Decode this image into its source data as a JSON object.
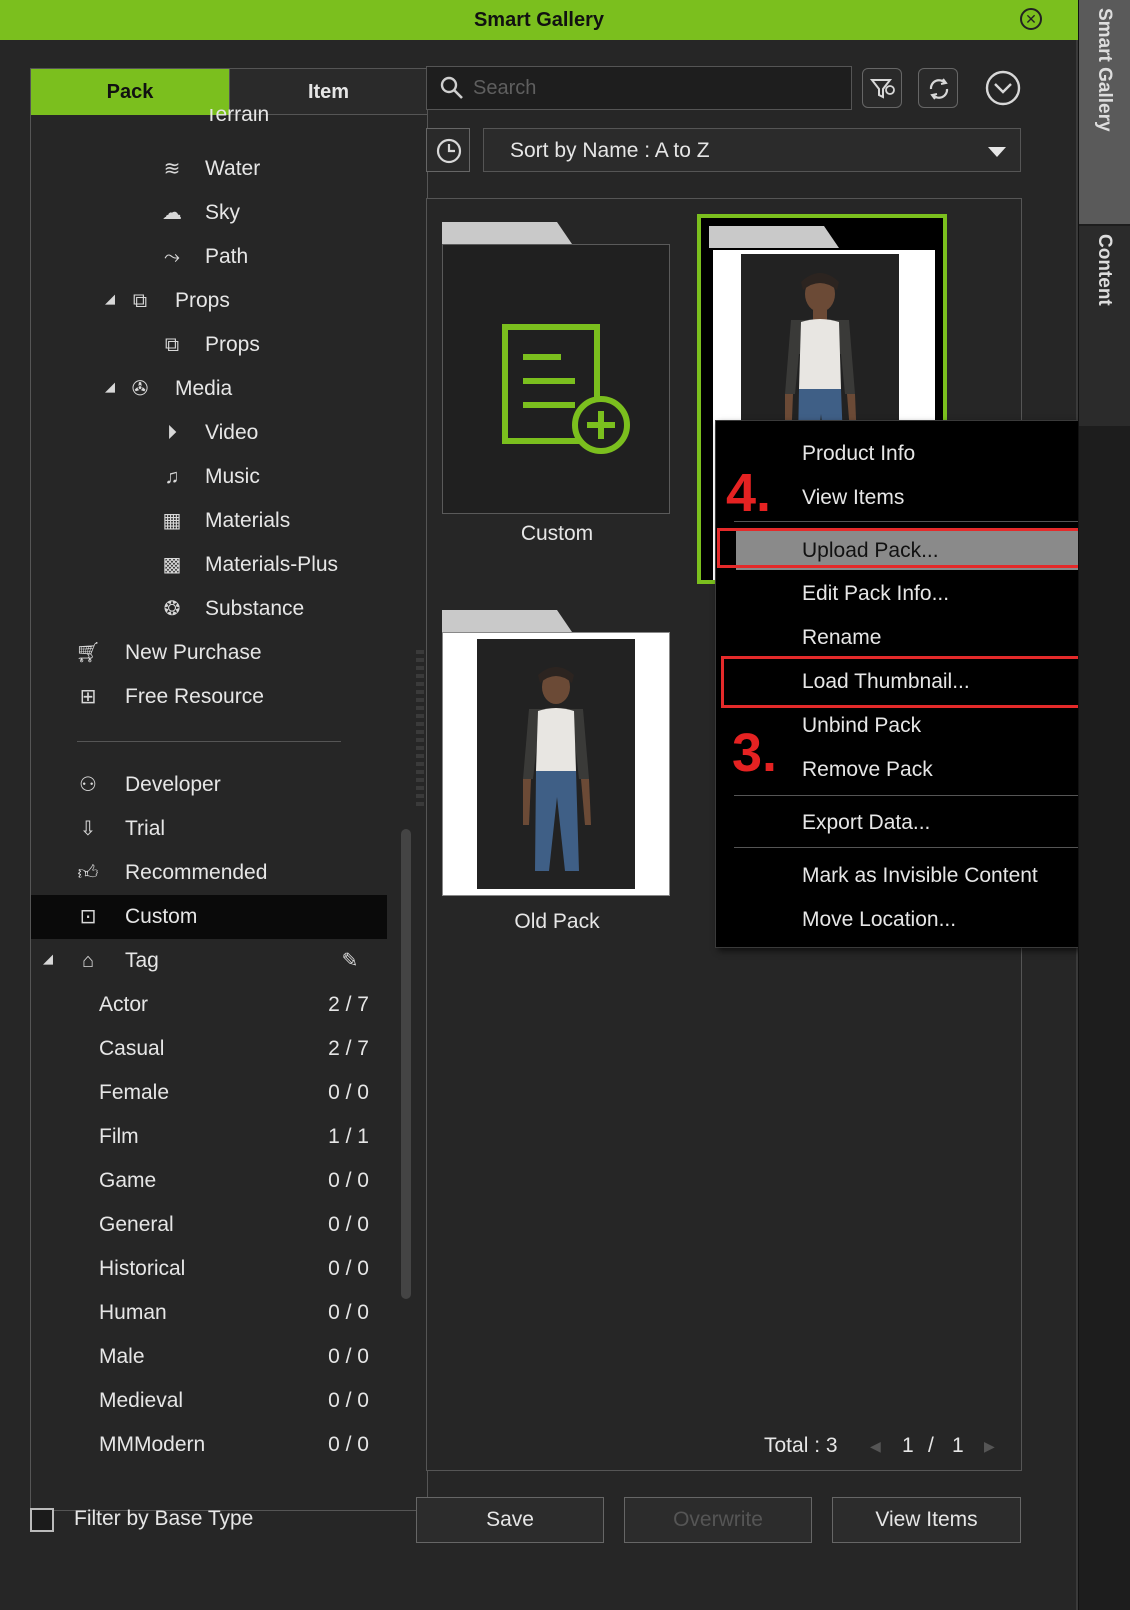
{
  "window": {
    "title": "Smart Gallery"
  },
  "rail": {
    "tabs": [
      "Smart Gallery",
      "Content"
    ]
  },
  "left": {
    "tabs": {
      "pack": "Pack",
      "item": "Item"
    },
    "tree": [
      {
        "label": "Terrain",
        "icon": "terrain-icon",
        "partial": true
      },
      {
        "label": "Water",
        "icon": "water-icon"
      },
      {
        "label": "Sky",
        "icon": "cloud-icon"
      },
      {
        "label": "Path",
        "icon": "path-icon"
      },
      {
        "label": "Props",
        "icon": "props-icon",
        "expanded": true
      },
      {
        "label": "Props",
        "icon": "props-icon"
      },
      {
        "label": "Media",
        "icon": "media-icon",
        "expanded": true
      },
      {
        "label": "Video",
        "icon": "play-icon"
      },
      {
        "label": "Music",
        "icon": "music-note-icon"
      },
      {
        "label": "Materials",
        "icon": "checker-icon"
      },
      {
        "label": "Materials-Plus",
        "icon": "checker-plus-icon"
      },
      {
        "label": "Substance",
        "icon": "substance-icon"
      },
      {
        "label": "New Purchase",
        "icon": "cart-icon"
      },
      {
        "label": "Free Resource",
        "icon": "gift-icon"
      },
      {
        "label": "Developer",
        "icon": "developer-icon"
      },
      {
        "label": "Trial",
        "icon": "trial-icon"
      },
      {
        "label": "Recommended",
        "icon": "thumbs-up-icon"
      },
      {
        "label": "Custom",
        "icon": "custom-icon",
        "selected": true
      },
      {
        "label": "Tag",
        "icon": "tag-icon",
        "expanded": true
      }
    ],
    "tags": [
      {
        "label": "Actor",
        "count": "2 / 7"
      },
      {
        "label": "Casual",
        "count": "2 / 7"
      },
      {
        "label": "Female",
        "count": "0 / 0"
      },
      {
        "label": "Film",
        "count": "1 / 1"
      },
      {
        "label": "Game",
        "count": "0 / 0"
      },
      {
        "label": "General",
        "count": "0 / 0"
      },
      {
        "label": "Historical",
        "count": "0 / 0"
      },
      {
        "label": "Human",
        "count": "0 / 0"
      },
      {
        "label": "Male",
        "count": "0 / 0"
      },
      {
        "label": "Medieval",
        "count": "0 / 0"
      },
      {
        "label": "MMModern",
        "count": "0 / 0"
      }
    ],
    "filter_label": "Filter by Base Type"
  },
  "search": {
    "placeholder": "Search"
  },
  "sort": {
    "label": "Sort by Name : A to Z"
  },
  "gallery": {
    "cards": [
      {
        "name": "Custom"
      },
      {
        "name": ""
      },
      {
        "name": "Old Pack"
      }
    ],
    "pager": {
      "total": "Total : 3",
      "page": "1",
      "slash": "/",
      "pages": "1"
    }
  },
  "buttons": {
    "save": "Save",
    "overwrite": "Overwrite",
    "view_items": "View Items"
  },
  "context_menu": {
    "items": [
      "Product Info",
      "View Items",
      "Upload Pack...",
      "Edit Pack Info...",
      "Rename",
      "Load Thumbnail...",
      "Unbind Pack",
      "Remove Pack",
      "Export Data...",
      "Mark as Invisible Content",
      "Move Location..."
    ],
    "annotations": {
      "step4": "4.",
      "step3": "3."
    }
  },
  "colors": {
    "accent": "#7bbf1e",
    "highlight": "#e52a2a",
    "panel": "#262626"
  }
}
